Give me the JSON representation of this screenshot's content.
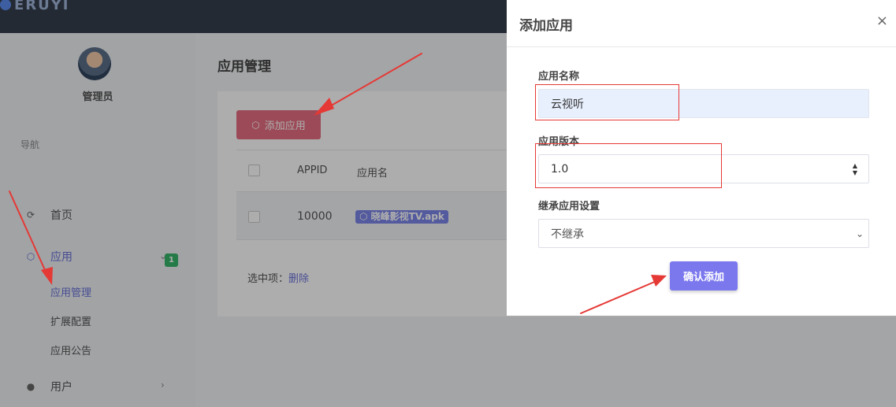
{
  "app": {
    "logo_text": "ERUYI"
  },
  "sidebar": {
    "admin_name": "管理员",
    "nav_label": "导航",
    "items": [
      {
        "label": "首页",
        "icon": "refresh-icon"
      },
      {
        "label": "应用",
        "icon": "cube-icon",
        "expanded": true
      },
      {
        "label": "用户",
        "icon": "user-icon"
      }
    ],
    "sub_items": [
      {
        "label": "应用管理",
        "badge": "1"
      },
      {
        "label": "扩展配置"
      },
      {
        "label": "应用公告"
      }
    ]
  },
  "main": {
    "page_title": "应用管理",
    "add_button": "添加应用",
    "table": {
      "headers": [
        "APPID",
        "应用名"
      ],
      "rows": [
        {
          "appid": "10000",
          "name": "晓峰影视TV.apk"
        }
      ]
    },
    "selected_label": "选中项：",
    "delete_link": "删除"
  },
  "modal": {
    "title": "添加应用",
    "close": "×",
    "name_label": "应用名称",
    "name_value": "云视听",
    "version_label": "应用版本",
    "version_value": "1.0",
    "inherit_label": "继承应用设置",
    "inherit_value": "不继承",
    "confirm_button": "确认添加"
  },
  "colors": {
    "accent": "#7b78ee",
    "add_button": "#e66d80",
    "annotation": "#e53935",
    "badge": "#35b56b"
  }
}
